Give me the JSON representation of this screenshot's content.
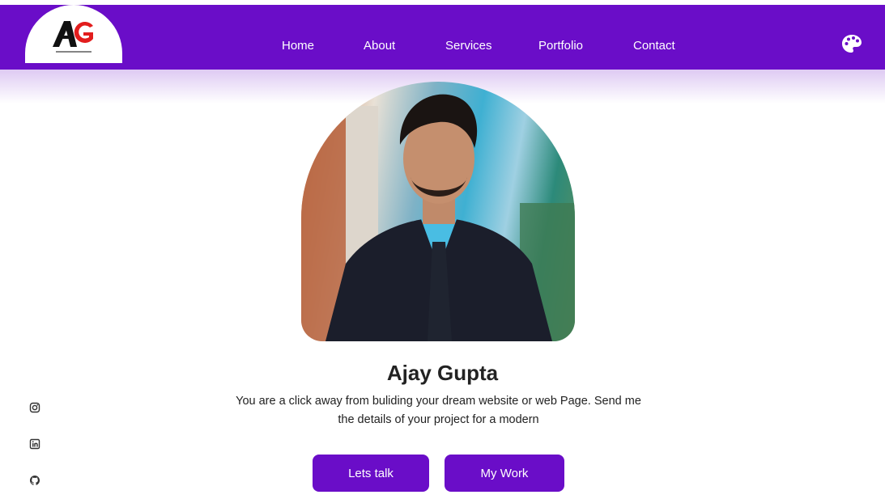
{
  "header": {
    "logo_alt": "AG",
    "nav": [
      {
        "label": "Home"
      },
      {
        "label": "About"
      },
      {
        "label": "Services"
      },
      {
        "label": "Portfolio"
      },
      {
        "label": "Contact"
      }
    ],
    "theme_icon": "palette-icon"
  },
  "hero": {
    "name": "Ajay Gupta",
    "bio_line1": "You are a click away from buliding your dream website or web Page. Send me",
    "bio_line2": "the details of your project for a modern",
    "buttons": {
      "primary": "Lets talk",
      "secondary": "My Work"
    }
  },
  "social": [
    {
      "icon": "instagram-icon"
    },
    {
      "icon": "linkedin-icon"
    },
    {
      "icon": "github-icon"
    }
  ],
  "colors": {
    "accent": "#6a0dc8",
    "text": "#222222",
    "background": "#ffffff"
  }
}
